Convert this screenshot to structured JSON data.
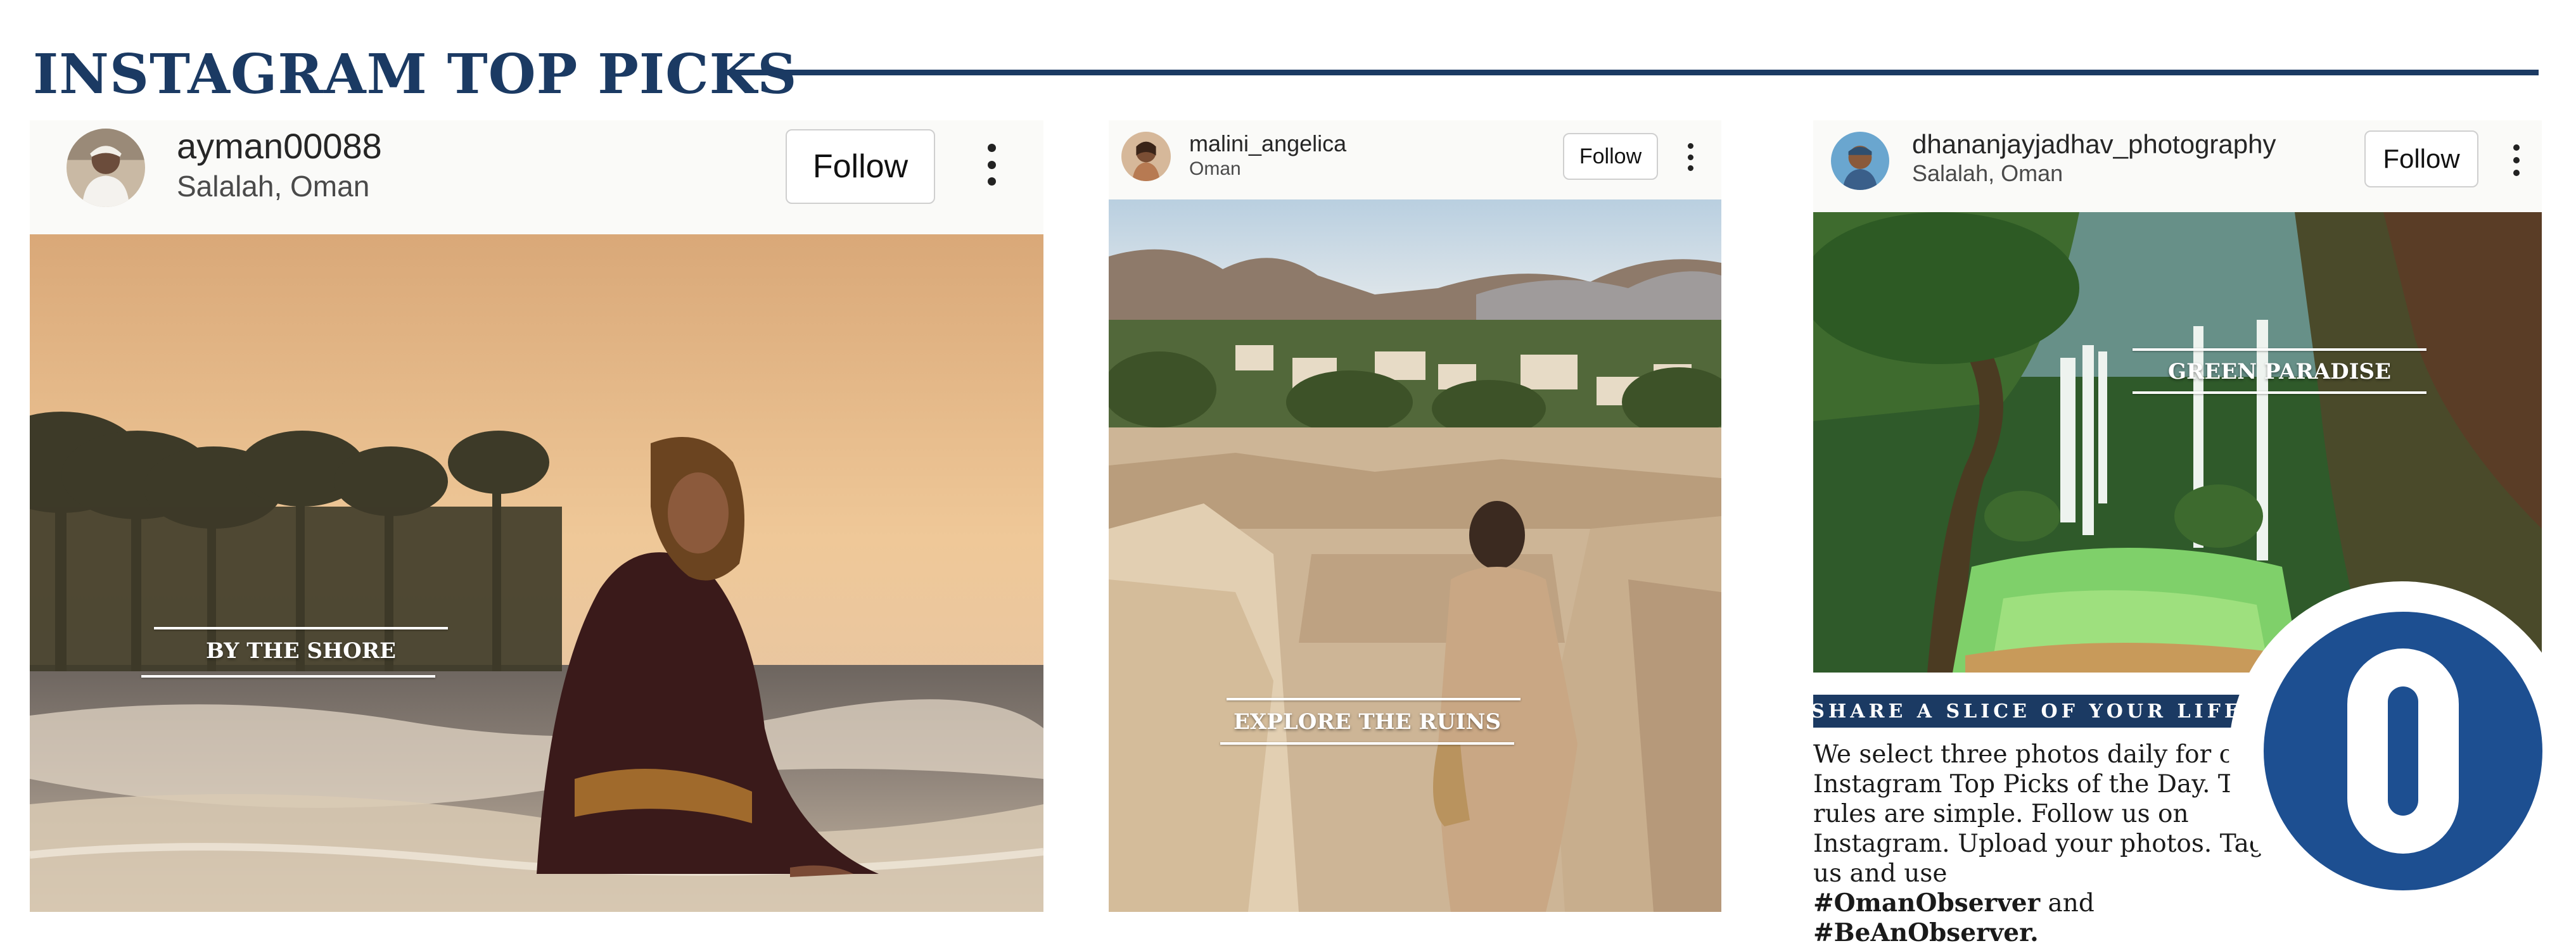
{
  "header": {
    "title": "INSTAGRAM TOP PICKS"
  },
  "posts": [
    {
      "username": "ayman00088",
      "location": "Salalah, Oman",
      "follow_label": "Follow",
      "more_icon": "more-vertical-icon",
      "caption": "BY THE SHORE"
    },
    {
      "username": "malini_angelica",
      "location": "Oman",
      "follow_label": "Follow",
      "more_icon": "more-vertical-icon",
      "caption": "EXPLORE THE RUINS"
    },
    {
      "username": "dhananjayjadhav_photography",
      "location": "Salalah, Oman",
      "follow_label": "Follow",
      "more_icon": "more-vertical-icon",
      "caption": "GREEN PARADISE"
    }
  ],
  "info": {
    "share_heading": "SHARE A SLICE OF YOUR LIFE",
    "body": "We select three photos daily for our Instagram Top Picks of the Day. The rules are simple. Follow us on Instagram. Upload your photos. Tag us and use",
    "hashtag_1": "#OmanObserver",
    "conjunction": "and",
    "hashtag_2": "#BeAnObserver."
  },
  "colors": {
    "brand_navy": "#1b3a63",
    "logo_blue": "#1d4f91",
    "caption_white": "#ffffff"
  }
}
